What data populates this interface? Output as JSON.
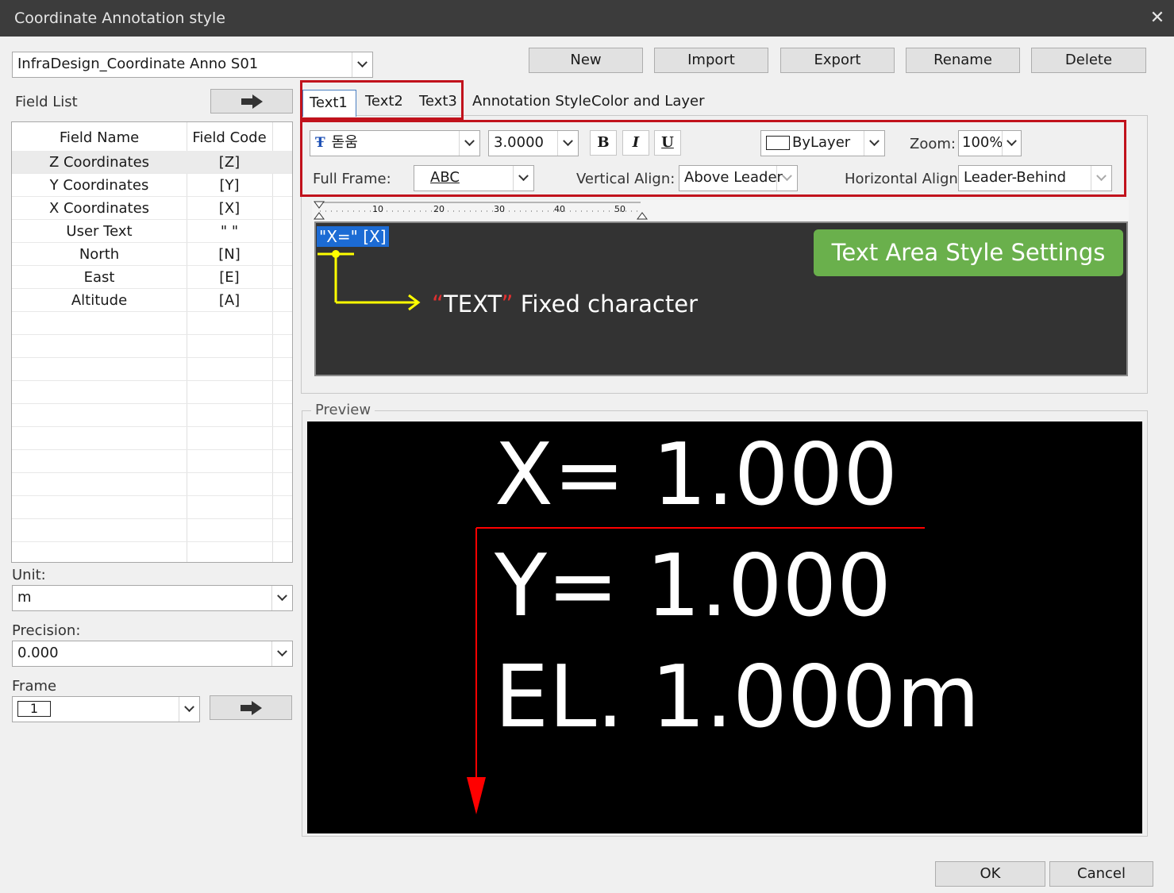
{
  "window": {
    "title": "Coordinate Annotation style",
    "close_glyph": "✕"
  },
  "style_select": {
    "value": "InfraDesign_Coordinate Anno S01"
  },
  "toolbar": {
    "new": "New",
    "import": "Import",
    "export": "Export",
    "rename": "Rename",
    "delete": "Delete"
  },
  "field_list": {
    "label": "Field List",
    "headers": {
      "name": "Field Name",
      "code": "Field Code"
    },
    "rows": [
      {
        "name": "Z Coordinates",
        "code": "[Z]"
      },
      {
        "name": "Y Coordinates",
        "code": "[Y]"
      },
      {
        "name": "X Coordinates",
        "code": "[X]"
      },
      {
        "name": "User Text",
        "code": "\" \""
      },
      {
        "name": "North",
        "code": "[N]"
      },
      {
        "name": "East",
        "code": "[E]"
      },
      {
        "name": "Altitude",
        "code": "[A]"
      }
    ]
  },
  "unit": {
    "label": "Unit:",
    "value": "m"
  },
  "precision": {
    "label": "Precision:",
    "value": "0.000"
  },
  "frame": {
    "label": "Frame",
    "value": "1"
  },
  "tabs": [
    {
      "label": "Text1",
      "active": true
    },
    {
      "label": "Text2",
      "active": false
    },
    {
      "label": "Text3",
      "active": false
    },
    {
      "label": "Annotation Style",
      "active": false
    },
    {
      "label": "Color and Layer",
      "active": false
    }
  ],
  "text_style": {
    "font": "돋움",
    "height": "3.0000",
    "bold": "B",
    "italic": "I",
    "underline": "U",
    "color": "ByLayer",
    "zoom_label": "Zoom:",
    "zoom": "100%",
    "full_frame_label": "Full Frame:",
    "full_frame": "ABC",
    "vertical_align_label": "Vertical Align:",
    "vertical_align": "Above Leader",
    "horizontal_align_label": "Horizontal Align:",
    "horizontal_align": "Leader-Behind"
  },
  "ruler": {
    "ticks": [
      "10",
      "20",
      "30",
      "40",
      "50"
    ]
  },
  "editor": {
    "content": "\"X=\" [X]"
  },
  "annotations": {
    "badge": "Text Area Style Settings",
    "quote_open": "“",
    "note_word": "TEXT",
    "quote_close": "”",
    "note_rest": " Fixed character"
  },
  "preview": {
    "label": "Preview",
    "lines": [
      "X= 1.000",
      "Y= 1.000",
      "EL. 1.000m"
    ]
  },
  "dialog_buttons": {
    "ok": "OK",
    "cancel": "Cancel"
  },
  "colors": {
    "highlight_red": "#c1121c",
    "badge_green": "#6ab04c",
    "selection_blue": "#1c6bd4",
    "arrow_yellow": "#ffff00",
    "leader_red": "#ff0000"
  }
}
